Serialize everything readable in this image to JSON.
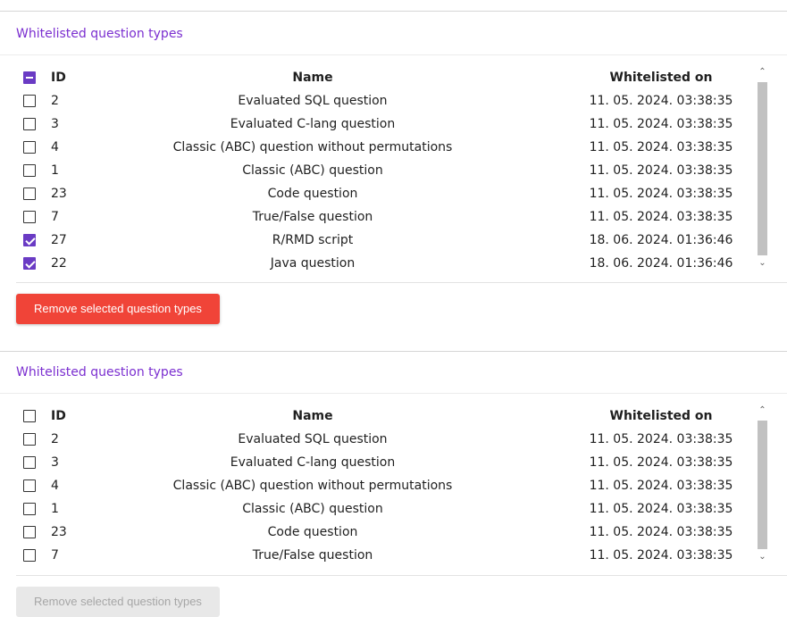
{
  "panels": [
    {
      "title": "Whitelisted question types",
      "columns": {
        "id": "ID",
        "name": "Name",
        "date": "Whitelisted on"
      },
      "header_checkbox": "indeterminate",
      "rows": [
        {
          "id": "2",
          "name": "Evaluated SQL question",
          "date": "11. 05. 2024. 03:38:35",
          "checked": false
        },
        {
          "id": "3",
          "name": "Evaluated C-lang question",
          "date": "11. 05. 2024. 03:38:35",
          "checked": false
        },
        {
          "id": "4",
          "name": "Classic (ABC) question without permutations",
          "date": "11. 05. 2024. 03:38:35",
          "checked": false
        },
        {
          "id": "1",
          "name": "Classic (ABC) question",
          "date": "11. 05. 2024. 03:38:35",
          "checked": false
        },
        {
          "id": "23",
          "name": "Code question",
          "date": "11. 05. 2024. 03:38:35",
          "checked": false
        },
        {
          "id": "7",
          "name": "True/False question",
          "date": "11. 05. 2024. 03:38:35",
          "checked": false
        },
        {
          "id": "27",
          "name": "R/RMD script",
          "date": "18. 06. 2024. 01:36:46",
          "checked": true
        },
        {
          "id": "22",
          "name": "Java question",
          "date": "18. 06. 2024. 01:36:46",
          "checked": true
        }
      ],
      "button_label": "Remove selected question types",
      "button_enabled": true
    },
    {
      "title": "Whitelisted question types",
      "columns": {
        "id": "ID",
        "name": "Name",
        "date": "Whitelisted on"
      },
      "header_checkbox": "unchecked",
      "rows": [
        {
          "id": "2",
          "name": "Evaluated SQL question",
          "date": "11. 05. 2024. 03:38:35",
          "checked": false
        },
        {
          "id": "3",
          "name": "Evaluated C-lang question",
          "date": "11. 05. 2024. 03:38:35",
          "checked": false
        },
        {
          "id": "4",
          "name": "Classic (ABC) question without permutations",
          "date": "11. 05. 2024. 03:38:35",
          "checked": false
        },
        {
          "id": "1",
          "name": "Classic (ABC) question",
          "date": "11. 05. 2024. 03:38:35",
          "checked": false
        },
        {
          "id": "23",
          "name": "Code question",
          "date": "11. 05. 2024. 03:38:35",
          "checked": false
        },
        {
          "id": "7",
          "name": "True/False question",
          "date": "11. 05. 2024. 03:38:35",
          "checked": false
        }
      ],
      "button_label": "Remove selected question types",
      "button_enabled": false
    }
  ],
  "icons": {
    "scroll_up": "chevron-up-icon",
    "scroll_down": "chevron-down-icon"
  },
  "colors": {
    "accent": "#7b2fd0",
    "checkbox": "#6a3bc4",
    "danger": "#f04438",
    "disabled_bg": "#e8e8e8",
    "disabled_text": "#a6a6a6"
  }
}
